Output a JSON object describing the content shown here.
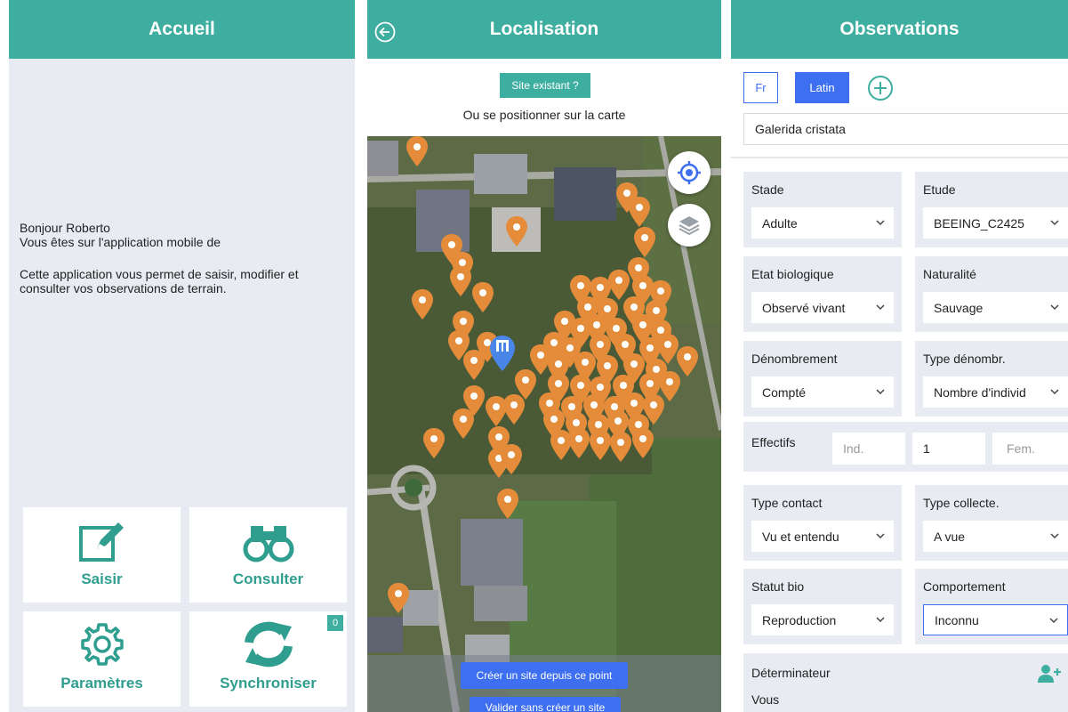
{
  "home": {
    "title": "Accueil",
    "greeting": "Bonjour Roberto",
    "intro": "Vous êtes sur l'application mobile de",
    "description_1": "Cette application vous permet de saisir, modifier et",
    "description_2": "consulter vos observations de terrain.",
    "tiles": {
      "saisir": "Saisir",
      "consulter": "Consulter",
      "parametres": "Paramètres",
      "synchroniser": "Synchroniser"
    },
    "sync_count": "0"
  },
  "localisation": {
    "title": "Localisation",
    "existing_site_button": "Site existant ?",
    "map_hint": "Ou se positionner sur la carte",
    "create_site_button": "Créer un site depuis ce point",
    "validate_button": "Valider sans créer un site"
  },
  "observations": {
    "title": "Observations",
    "lang_fr": "Fr",
    "lang_latin": "Latin",
    "species_value": "Galerida cristata",
    "fields": {
      "stade": {
        "label": "Stade",
        "value": "Adulte"
      },
      "etude": {
        "label": "Etude",
        "value": "BEEING_C2425"
      },
      "etat": {
        "label": "Etat biologique",
        "value": "Observé vivant"
      },
      "naturalite": {
        "label": "Naturalité",
        "value": "Sauvage"
      },
      "denombrement": {
        "label": "Dénombrement",
        "value": "Compté"
      },
      "type_denombr": {
        "label": "Type dénombr.",
        "value": "Nombre d'individ"
      },
      "type_contact": {
        "label": "Type contact",
        "value": "Vu et entendu"
      },
      "type_collecte": {
        "label": "Type collecte.",
        "value": "A vue"
      },
      "statut_bio": {
        "label": "Statut bio",
        "value": "Reproduction"
      },
      "comportement": {
        "label": "Comportement",
        "value": "Inconnu"
      }
    },
    "effectifs": {
      "label": "Effectifs",
      "ind_placeholder": "Ind.",
      "count": "1",
      "fem_placeholder": "Fem."
    },
    "determinateur": {
      "label": "Déterminateur",
      "value": "Vous"
    }
  },
  "colors": {
    "header": "#3dae9f",
    "accent_blue": "#3d6ff0",
    "marker": "#e58c3a",
    "panel_bg": "#e8ebf1"
  }
}
